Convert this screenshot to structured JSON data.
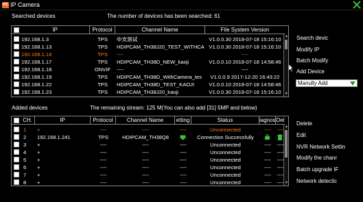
{
  "window": {
    "title": "IP Camera",
    "icon_text": "IPC"
  },
  "searched": {
    "section_label": "Searched devices",
    "count_text": "The number of devices has been searched: 61",
    "columns": [
      "IP",
      "Protocol",
      "Channel Name",
      "File System Version"
    ],
    "rows": [
      {
        "ip": "192.168.1.3",
        "protocol": "TPS",
        "channel": "中文测试",
        "version": "V1.0.0.30 2018-07-18 15:16:10",
        "selected": false
      },
      {
        "ip": "192.168.1.13",
        "protocol": "TPS",
        "channel": "HDIPCAM_TH38J20_TEST_WITHCA",
        "version": "V1.0.0.30 2018-07-18 15:16:10",
        "selected": false
      },
      {
        "ip": "192.168.1.14",
        "protocol": "TPS",
        "channel": "----",
        "version": "----",
        "selected": true
      },
      {
        "ip": "192.168.1.17",
        "protocol": "TPS",
        "channel": "HDIPCAM_TH38D_NEW_kaoji",
        "version": "V1.0.0.10 2018-07-18 14:58:46",
        "selected": false
      },
      {
        "ip": "192.168.1.18",
        "protocol": "ONVIF",
        "channel": "----",
        "version": "----",
        "selected": false
      },
      {
        "ip": "192.168.1.19",
        "protocol": "TPS",
        "channel": "HDIPCAM_TH38D_WithCamera_tes",
        "version": "V1.0.0.9 2017-12-20 16:43:22",
        "selected": false
      },
      {
        "ip": "192.168.1.22",
        "protocol": "TPS",
        "channel": "HDIPCAM_TH38D_TEST_KAOJI",
        "version": "V1.0.0.10 2018-07-18 14:58:46",
        "selected": false
      },
      {
        "ip": "192.168.1.23",
        "protocol": "TPS",
        "channel": "HDIPCAM_TH38J20_kaoji",
        "version": "V1.0.0.30 2018-07-18 15:16:10",
        "selected": false
      }
    ]
  },
  "added": {
    "section_label": "Added devices",
    "remaining_text": "The remaining stream: 125 M(You can also add [31] 5MP and below)",
    "columns": [
      "CH.",
      "IP",
      "Protocol",
      "Channel Name",
      "etting",
      "Status",
      "iagnos",
      "Del"
    ],
    "rows": [
      {
        "ch": "1",
        "ip": "+",
        "protocol": "----",
        "channel": "----",
        "setting": "----",
        "status": "Unconnected",
        "diag": "----",
        "del": "----",
        "selected": true,
        "icons": false
      },
      {
        "ch": "2",
        "ip": "192.168.1.241",
        "protocol": "TPS",
        "channel": "HDIPCAM_TH38Q8",
        "setting": "",
        "status": "Connection Successfully",
        "diag": "",
        "del": "",
        "selected": false,
        "icons": true
      },
      {
        "ch": "3",
        "ip": "+",
        "protocol": "----",
        "channel": "----",
        "setting": "----",
        "status": "Unconnected",
        "diag": "----",
        "del": "----",
        "selected": false,
        "icons": false
      },
      {
        "ch": "4",
        "ip": "+",
        "protocol": "----",
        "channel": "----",
        "setting": "----",
        "status": "Unconnected",
        "diag": "----",
        "del": "----",
        "selected": false,
        "icons": false
      },
      {
        "ch": "5",
        "ip": "+",
        "protocol": "----",
        "channel": "----",
        "setting": "----",
        "status": "Unconnected",
        "diag": "----",
        "del": "----",
        "selected": false,
        "icons": false
      },
      {
        "ch": "6",
        "ip": "+",
        "protocol": "----",
        "channel": "----",
        "setting": "----",
        "status": "Unconnected",
        "diag": "----",
        "del": "----",
        "selected": false,
        "icons": false
      },
      {
        "ch": "7",
        "ip": "+",
        "protocol": "----",
        "channel": "----",
        "setting": "----",
        "status": "Unconnected",
        "diag": "----",
        "del": "----",
        "selected": false,
        "icons": false
      },
      {
        "ch": "8",
        "ip": "+",
        "protocol": "----",
        "channel": "----",
        "setting": "----",
        "status": "Unconnected",
        "diag": "----",
        "del": "----",
        "selected": false,
        "icons": false
      }
    ]
  },
  "right_panel_top": {
    "search_label": "Search devic",
    "modify_ip_label": "Modify IP",
    "batch_modify_label": "Batch Modify",
    "add_device_label": "Add Device",
    "add_mode_value": "Manully Add"
  },
  "right_panel_bottom": {
    "delete_label": "Delete",
    "edit_label": "Edit",
    "nvr_settings_label": "NVR Network Settin",
    "modify_channel_label": "Modify the chanr",
    "batch_upgrade_label": "Batch upgrade IF",
    "network_detect_label": "Network detectic"
  },
  "colors": {
    "accent": "#ff7a1a",
    "green": "#2e8b2e",
    "icon_green": "#3bbf3b",
    "background": "#000000"
  }
}
